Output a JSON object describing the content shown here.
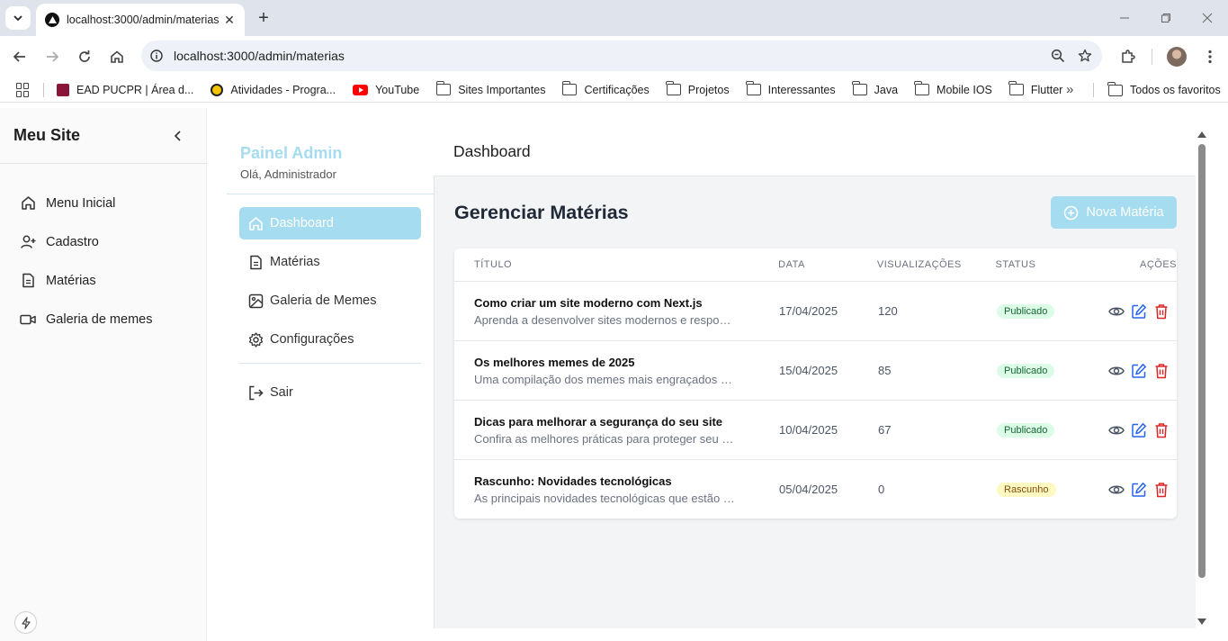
{
  "browser": {
    "tab_title": "localhost:3000/admin/materias",
    "url": "localhost:3000/admin/materias",
    "bookmarks": [
      {
        "label": "EAD PUCPR | Área d...",
        "icon": "pucpr-icon"
      },
      {
        "label": "Atividades - Progra...",
        "icon": "activity-icon"
      },
      {
        "label": "YouTube",
        "icon": "youtube-icon"
      },
      {
        "label": "Sites Importantes",
        "icon": "folder-icon"
      },
      {
        "label": "Certificações",
        "icon": "folder-icon"
      },
      {
        "label": "Projetos",
        "icon": "folder-icon"
      },
      {
        "label": "Interessantes",
        "icon": "folder-icon"
      },
      {
        "label": "Java",
        "icon": "folder-icon"
      },
      {
        "label": "Mobile IOS",
        "icon": "folder-icon"
      },
      {
        "label": "Flutter",
        "icon": "folder-icon"
      }
    ],
    "all_bookmarks": "Todos os favoritos"
  },
  "site": {
    "title": "Meu Site",
    "nav": [
      {
        "label": "Menu Inicial",
        "icon": "home-icon"
      },
      {
        "label": "Cadastro",
        "icon": "user-plus-icon"
      },
      {
        "label": "Matérias",
        "icon": "file-text-icon"
      },
      {
        "label": "Galeria de memes",
        "icon": "video-icon"
      }
    ]
  },
  "admin": {
    "title": "Painel Admin",
    "greeting": "Olá, Administrador",
    "nav": [
      {
        "label": "Dashboard",
        "icon": "home-icon",
        "active": true
      },
      {
        "label": "Matérias",
        "icon": "file-text-icon",
        "active": false
      },
      {
        "label": "Galeria de Memes",
        "icon": "image-icon",
        "active": false
      },
      {
        "label": "Configurações",
        "icon": "gear-icon",
        "active": false
      }
    ],
    "logout": "Sair"
  },
  "main": {
    "topbar_title": "Dashboard",
    "heading": "Gerenciar Matérias",
    "new_button": "Nova Matéria",
    "columns": [
      "TÍTULO",
      "DATA",
      "VISUALIZAÇÕES",
      "STATUS",
      "AÇÕES"
    ],
    "rows": [
      {
        "title": "Como criar um site moderno com Next.js",
        "desc": "Aprenda a desenvolver sites modernos e responsi...",
        "date": "17/04/2025",
        "views": "120",
        "status": "Publicado",
        "status_kind": "published"
      },
      {
        "title": "Os melhores memes de 2025",
        "desc": "Uma compilação dos memes mais engraçados e v...",
        "date": "15/04/2025",
        "views": "85",
        "status": "Publicado",
        "status_kind": "published"
      },
      {
        "title": "Dicas para melhorar a segurança do seu site",
        "desc": "Confira as melhores práticas para proteger seu sit...",
        "date": "10/04/2025",
        "views": "67",
        "status": "Publicado",
        "status_kind": "published"
      },
      {
        "title": "Rascunho: Novidades tecnológicas",
        "desc": "As principais novidades tecnológicas que estão p...",
        "date": "05/04/2025",
        "views": "0",
        "status": "Rascunho",
        "status_kind": "draft"
      }
    ]
  },
  "colors": {
    "accent": "#a6dcef",
    "published_bg": "#dcfce7",
    "draft_bg": "#fef9c3",
    "edit": "#2563eb",
    "delete": "#dc2626"
  }
}
